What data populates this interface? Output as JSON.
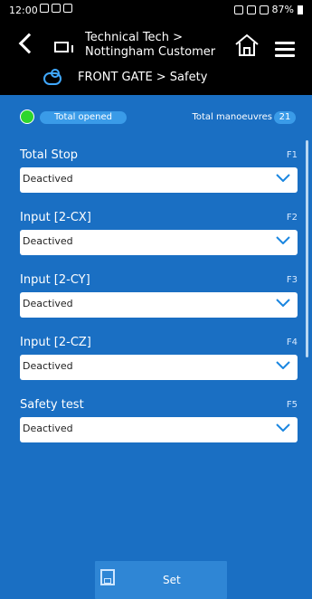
{
  "status_bar": {
    "time": "12:00",
    "battery": "87%"
  },
  "header": {
    "title_line1": "Technical Tech >",
    "title_line2": "Nottingham Customer",
    "breadcrumb": "FRONT GATE > Safety"
  },
  "summary": {
    "state_label": "Total opened",
    "manoeuvres_label": "Total manoeuvres",
    "manoeuvres_count": "21"
  },
  "fields": [
    {
      "label": "Total Stop",
      "code": "F1",
      "value": "Deactived"
    },
    {
      "label": "Input [2-CX]",
      "code": "F2",
      "value": "Deactived"
    },
    {
      "label": "Input [2-CY]",
      "code": "F3",
      "value": "Deactived"
    },
    {
      "label": "Input [2-CZ]",
      "code": "F4",
      "value": "Deactived"
    },
    {
      "label": "Safety test",
      "code": "F5",
      "value": "Deactived"
    }
  ],
  "footer": {
    "set_label": "Set"
  },
  "colors": {
    "primary_blue": "#1a6fc3",
    "accent_green": "#2dd62d"
  }
}
